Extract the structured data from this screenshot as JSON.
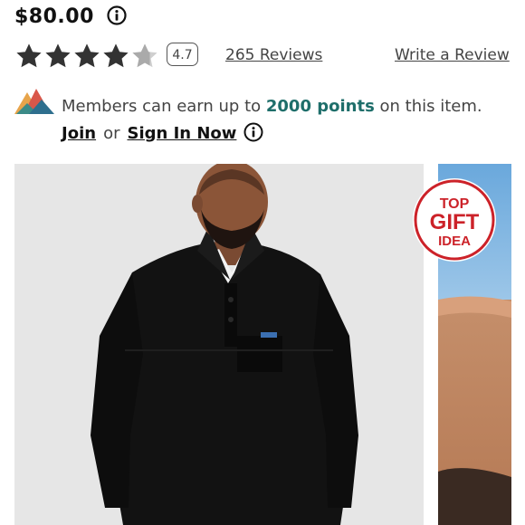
{
  "product": {
    "price": "$80.00",
    "rating_value": "4.7",
    "reviews_label": "265 Reviews",
    "write_review_label": "Write a Review",
    "stars": {
      "filled": 4,
      "total": 5
    }
  },
  "rewards": {
    "text_before": "Members can earn up to ",
    "points": "2000 points",
    "text_after": " on this item.",
    "join_label": "Join",
    "or_label": "or",
    "sign_in_label": "Sign In Now"
  },
  "badge": {
    "line1": "TOP",
    "line2": "GIFT",
    "line3": "IDEA"
  },
  "icons": {
    "price_info": "info-circle-icon",
    "rewards_info": "info-circle-icon",
    "rewards_logo": "mountains-logo-icon"
  },
  "colors": {
    "star": "#333333",
    "star_empty": "#bdbdbd",
    "points": "#1e6e6a",
    "badge": "#cc2229"
  }
}
